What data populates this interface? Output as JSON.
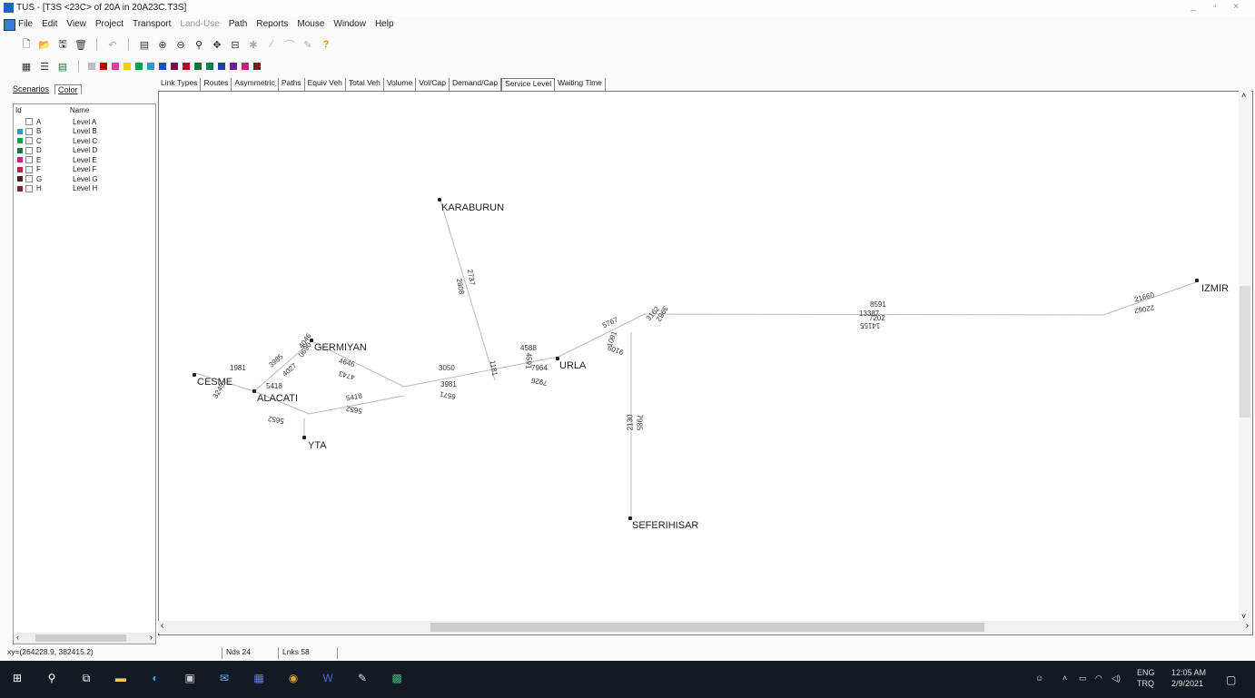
{
  "window": {
    "title": "TUS - [T3S <23C> of 20A in 20A23C.T3S]",
    "controls": "_ ▫ ×"
  },
  "menu": [
    "File",
    "Edit",
    "View",
    "Project",
    "Transport",
    "Land-Use",
    "Path",
    "Reports",
    "Mouse",
    "Window",
    "Help"
  ],
  "menu_disabled": [
    "Land-Use"
  ],
  "toolbar_colors": [
    "#bdbdbd",
    "#c00000",
    "#e040a0",
    "#f0d000",
    "#00a050",
    "#20a0c0",
    "#2050c0",
    "#801040",
    "#b00020",
    "#207030",
    "#108050",
    "#2040a0",
    "#6a2090",
    "#d02070",
    "#702020"
  ],
  "left_panel": {
    "tabs": [
      "Scenarios",
      "Color"
    ],
    "active_tab": "Color",
    "columns": [
      "Id",
      "Name"
    ],
    "rows": [
      {
        "id": "A",
        "name": "Level A",
        "color": ""
      },
      {
        "id": "B",
        "name": "Level B",
        "color": "#20a0c8"
      },
      {
        "id": "C",
        "name": "Level C",
        "color": "#10a050"
      },
      {
        "id": "D",
        "name": "Level D",
        "color": "#207040"
      },
      {
        "id": "E",
        "name": "Level E",
        "color": "#d02080"
      },
      {
        "id": "F",
        "name": "Level F",
        "color": "#c02040"
      },
      {
        "id": "G",
        "name": "Level G",
        "color": "#502020"
      },
      {
        "id": "H",
        "name": "Level H",
        "color": "#802030"
      }
    ]
  },
  "view_tabs": [
    "Link Types",
    "Routes",
    "Asymmetric",
    "Paths",
    "Equiv Veh",
    "Total Veh",
    "Volume",
    "Vol/Cap",
    "Demand/Cap",
    "Service Level",
    "Waiting Time"
  ],
  "active_view_tab": "Service Level",
  "map": {
    "nodes": {
      "karaburun": "KARABURUN",
      "germiyan": "GERMIYAN",
      "cesme": "CESME",
      "alacati": "ALACATI",
      "yta": "YTA",
      "urla": "URLA",
      "seferihisar": "SEFERIHISAR",
      "izmir": "IZMIR"
    },
    "link_values": [
      "1981",
      "3985",
      "4046",
      "4027",
      "0690",
      "4646",
      "4743",
      "3050",
      "3981",
      "5418",
      "5652",
      "5652",
      "4588",
      "4591",
      "7964",
      "7926",
      "5767",
      "1091",
      "9109",
      "3162",
      "3982",
      "8591",
      "13387",
      "7202",
      "14155",
      "21660",
      "22062",
      "2737",
      "2808",
      "1181",
      "6571",
      "2130",
      "7985",
      "3245",
      "5418"
    ]
  },
  "status": {
    "coords": "xy=(264228.9, 382415.2)",
    "nodes": "Nds 24",
    "links": "Lnks 58"
  },
  "taskbar": {
    "lang": "ENG",
    "locale": "TRQ",
    "time": "12:05 AM",
    "date": "2/9/2021"
  }
}
